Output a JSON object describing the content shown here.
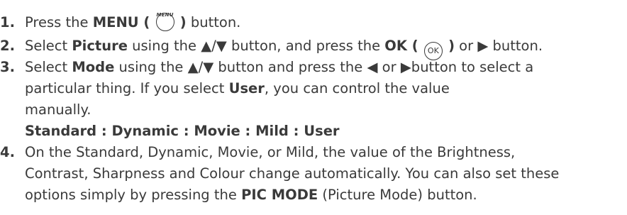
{
  "steps": {
    "s1": {
      "num": "1.",
      "t1": "Press the ",
      "b1": "MENU (",
      "menu_caption": "MENU",
      "b2": ")",
      "t2": " button."
    },
    "s2": {
      "num": "2.",
      "t1": "Select ",
      "b1": "Picture",
      "t2": " using the ▲/▼ button, and press the ",
      "b2": "OK (",
      "ok_glyph": "OK",
      "b3": ")",
      "t3": " or ▶ button."
    },
    "s3": {
      "num": "3.",
      "t1": "Select ",
      "b1": "Mode",
      "t2": " using the ▲/▼ button and press the ◀ or ▶button to select a",
      "l2_t1": "particular thing. If you select  ",
      "l2_b1": "User",
      "l2_t2": ", you can control the value",
      "l3": "manually.",
      "modes": "Standard : Dynamic : Movie : Mild : User"
    },
    "s4": {
      "num": "4.",
      "l1": "On the Standard, Dynamic, Movie, or Mild, the value of the Brightness,",
      "l2": "Contrast, Sharpness and Colour change automatically. You can also set these",
      "l3_t1": "options simply by pressing the ",
      "l3_b1": "PIC MODE",
      "l3_t2": " (Picture Mode) button."
    }
  }
}
